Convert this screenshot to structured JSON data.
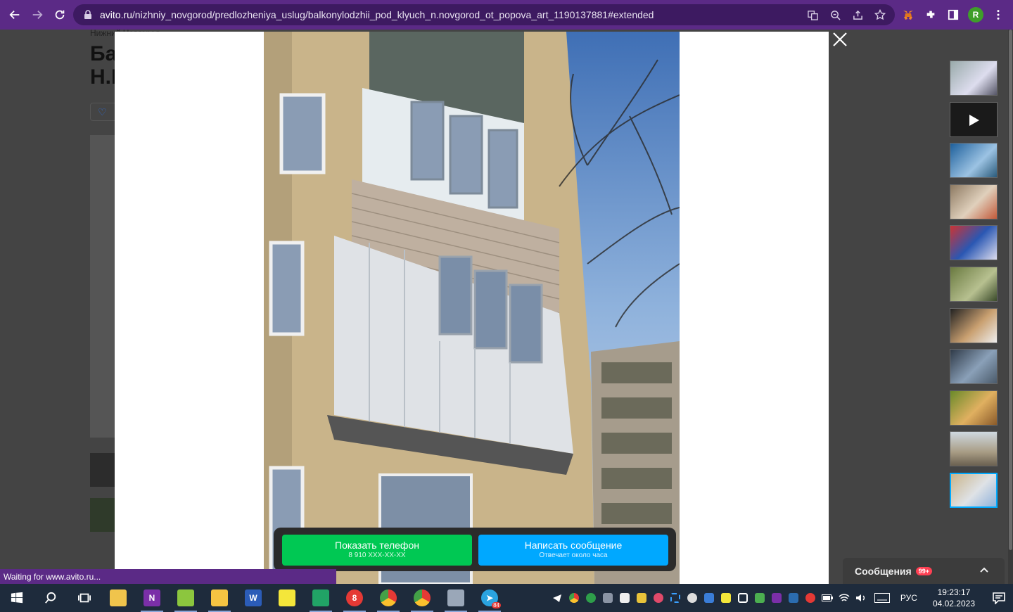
{
  "browser": {
    "url_domain": "avito.ru",
    "url_path": "/nizhniy_novgorod/predlozheniya_uslug/balkonylodzhii_pod_klyuch_n.novgorod_ot_popova_art_1190137881#extended",
    "profile_initial": "R",
    "status_text": "Waiting for www.avito.ru..."
  },
  "background_page": {
    "breadcrumb": "Нижний Новгород",
    "title_line1": "Ба",
    "title_line2": "Н.Н"
  },
  "viewer": {
    "buttons": {
      "phone_label": "Показать телефон",
      "phone_sub": "8 910 XXX-XX-XX",
      "message_label": "Написать сообщение",
      "message_sub": "Отвечает около часа"
    },
    "thumbnail_count": 11,
    "active_thumbnail": 11
  },
  "messages_panel": {
    "label": "Сообщения",
    "badge": "99+"
  },
  "taskbar": {
    "apps": [
      "start",
      "search",
      "task-view",
      "file-manager",
      "onenote",
      "notepad-plus",
      "explorer",
      "word",
      "sticky-notes",
      "sheets",
      "yandex",
      "chrome-user",
      "chrome",
      "trash",
      "telegram"
    ],
    "telegram_badge": "84",
    "language": "РУС",
    "time": "19:23:17",
    "date": "04.02.2023"
  }
}
